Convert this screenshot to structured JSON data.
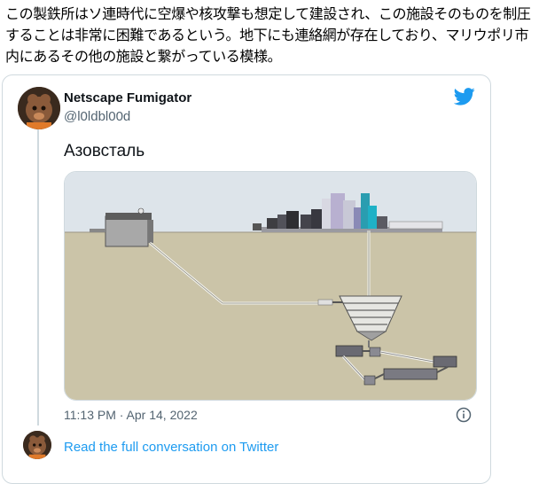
{
  "article": {
    "text": "この製鉄所はソ連時代に空爆や核攻撃も想定して建設され、この施設そのものを制圧することは非常に困難であるという。地下にも連絡網が存在しており、マリウポリ市内にあるその他の施設と繋がっている模様。"
  },
  "tweet": {
    "author_name": "Netscape Fumigator",
    "author_handle": "@l0ldbl00d",
    "text": "Азовсталь",
    "timestamp": "11:13 PM · Apr 14, 2022",
    "read_more": "Read the full conversation on Twitter",
    "icons": [
      "twitter-bird-icon",
      "info-icon"
    ],
    "colors": {
      "accent": "#1d9bf0",
      "secondary_text": "#536471",
      "border": "#cfd9de"
    }
  }
}
